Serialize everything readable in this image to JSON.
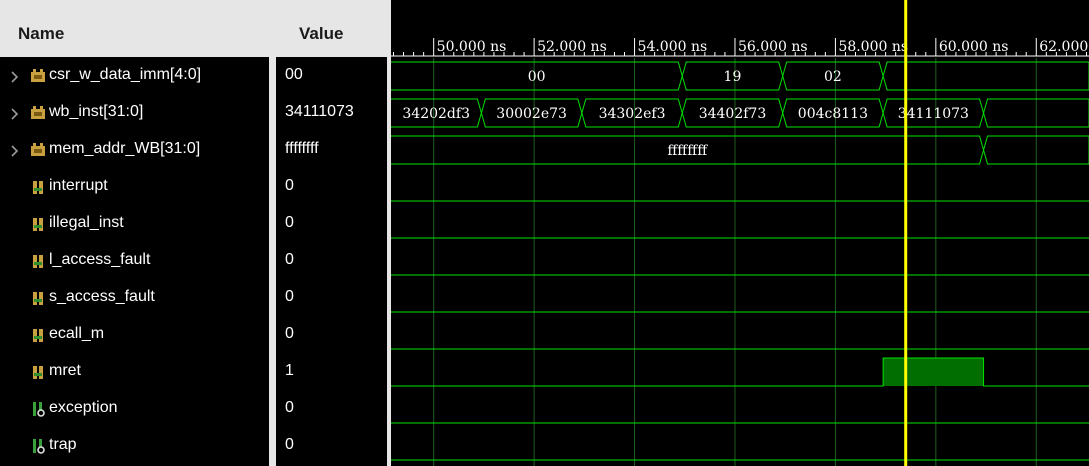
{
  "columns": {
    "name": "Name",
    "value": "Value"
  },
  "signals": [
    {
      "name": "csr_w_data_imm[4:0]",
      "value": "00",
      "expandable": true,
      "icon": "bus-icon"
    },
    {
      "name": "wb_inst[31:0]",
      "value": "34111073",
      "expandable": true,
      "icon": "bus-icon"
    },
    {
      "name": "mem_addr_WB[31:0]",
      "value": "ffffffff",
      "expandable": true,
      "icon": "bus-icon"
    },
    {
      "name": "interrupt",
      "value": "0",
      "expandable": false,
      "icon": "wire-icon"
    },
    {
      "name": "illegal_inst",
      "value": "0",
      "expandable": false,
      "icon": "wire-icon"
    },
    {
      "name": "l_access_fault",
      "value": "0",
      "expandable": false,
      "icon": "wire-icon"
    },
    {
      "name": "s_access_fault",
      "value": "0",
      "expandable": false,
      "icon": "wire-icon"
    },
    {
      "name": "ecall_m",
      "value": "0",
      "expandable": false,
      "icon": "wire-icon"
    },
    {
      "name": "mret",
      "value": "1",
      "expandable": false,
      "icon": "wire-icon"
    },
    {
      "name": "exception",
      "value": "0",
      "expandable": false,
      "icon": "output-icon"
    },
    {
      "name": "trap",
      "value": "0",
      "expandable": false,
      "icon": "output-icon"
    }
  ],
  "timeline": {
    "ticks": [
      "50.000 ns",
      "52.000 ns",
      "54.000 ns",
      "56.000 ns",
      "58.000 ns",
      "60.000 ns",
      "62.000 ns"
    ],
    "view_start_ns": 49.15,
    "view_end_ns": 63.05,
    "cursor_ns": 59.4
  },
  "waves": [
    {
      "type": "bus",
      "segments": [
        {
          "start": 49.15,
          "end": 54.95,
          "label": "00"
        },
        {
          "start": 54.95,
          "end": 56.95,
          "label": "19"
        },
        {
          "start": 56.95,
          "end": 58.95,
          "label": "02"
        },
        {
          "start": 58.95,
          "end": 63.05,
          "label": ""
        }
      ]
    },
    {
      "type": "bus",
      "segments": [
        {
          "start": 49.15,
          "end": 50.95,
          "label": "34202df3"
        },
        {
          "start": 50.95,
          "end": 52.95,
          "label": "30002e73"
        },
        {
          "start": 52.95,
          "end": 54.95,
          "label": "34302ef3"
        },
        {
          "start": 54.95,
          "end": 56.95,
          "label": "34402f73"
        },
        {
          "start": 56.95,
          "end": 58.95,
          "label": "004c8113"
        },
        {
          "start": 58.95,
          "end": 60.95,
          "label": "34111073"
        },
        {
          "start": 60.95,
          "end": 63.05,
          "label": ""
        }
      ]
    },
    {
      "type": "bus",
      "segments": [
        {
          "start": 49.15,
          "end": 60.95,
          "label": "ffffffff"
        },
        {
          "start": 60.95,
          "end": 63.05,
          "label": ""
        }
      ]
    },
    {
      "type": "bit",
      "levels": [
        {
          "start": 49.15,
          "end": 63.05,
          "value": 0
        }
      ]
    },
    {
      "type": "bit",
      "levels": [
        {
          "start": 49.15,
          "end": 63.05,
          "value": 0
        }
      ]
    },
    {
      "type": "bit",
      "levels": [
        {
          "start": 49.15,
          "end": 63.05,
          "value": 0
        }
      ]
    },
    {
      "type": "bit",
      "levels": [
        {
          "start": 49.15,
          "end": 63.05,
          "value": 0
        }
      ]
    },
    {
      "type": "bit",
      "levels": [
        {
          "start": 49.15,
          "end": 63.05,
          "value": 0
        }
      ]
    },
    {
      "type": "bit",
      "levels": [
        {
          "start": 49.15,
          "end": 58.95,
          "value": 0
        },
        {
          "start": 58.95,
          "end": 60.95,
          "value": 1
        },
        {
          "start": 60.95,
          "end": 63.05,
          "value": 0
        }
      ]
    },
    {
      "type": "bit",
      "levels": [
        {
          "start": 49.15,
          "end": 63.05,
          "value": 0
        }
      ]
    },
    {
      "type": "bit",
      "levels": [
        {
          "start": 49.15,
          "end": 63.05,
          "value": 0
        }
      ]
    }
  ],
  "colors": {
    "wave": "#00e000",
    "high_fill": "#006e00",
    "grid": "#1f5f1f",
    "cursor": "#ffff00",
    "ruler": "#ffffff",
    "background": "#000000"
  }
}
